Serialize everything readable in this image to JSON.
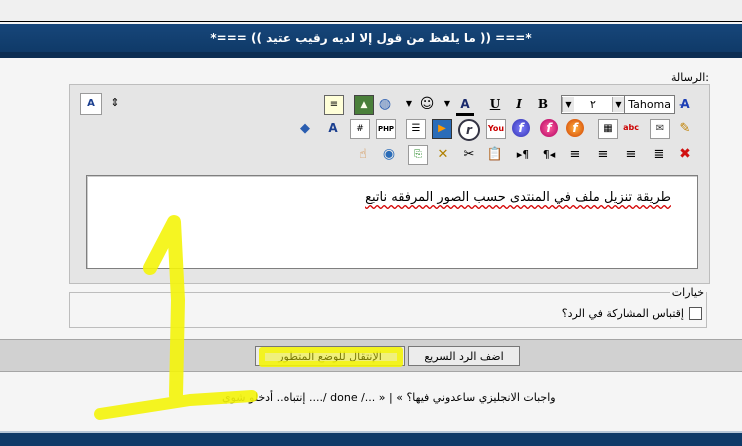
{
  "header": {
    "title": "*=== (( ما يلفظ من قول إلا لديه رقيب عتيد )) ===*"
  },
  "editor": {
    "label": "الرسالة:",
    "font_name": "Tahoma",
    "font_size": "٢",
    "toolbar_row1_icons": [
      "toggle-mode-icon",
      "bold-icon",
      "italic-icon",
      "underline-icon",
      "font-color-icon",
      "smilie-icon",
      "insert-link-icon",
      "insert-image-icon",
      "quote-icon"
    ],
    "toolbar_row2_icons": [
      "remove-format-icon",
      "wysiwyg-icon",
      "table-icon",
      "flash-icon",
      "flash-icon",
      "flash-icon",
      "youtube-icon",
      "real-player-icon",
      "media-player-icon",
      "list-icon",
      "php-icon",
      "code-icon",
      "highlight-icon",
      "book-icon"
    ],
    "toolbar_row3_icons": [
      "delete-icon",
      "align-justify-icon",
      "align-right-icon",
      "align-center-icon",
      "align-left-icon",
      "rtl-icon",
      "ltr-icon",
      "paste-icon",
      "cut-icon",
      "clear-icon",
      "copy-icon",
      "web-icon",
      "hand-icon"
    ],
    "message_text": "طريقة تنزيل ملف في المنتدى حسب الصور المرفقه ناتبع"
  },
  "options": {
    "legend": "خيارات",
    "quote_label": "إقتباس المشاركة في الرد؟",
    "quote_checked": false
  },
  "buttons": {
    "quick_reply": "اضف الرد السريع",
    "advanced": "الإنتقال للوضع المتطور"
  },
  "links": {
    "prev": "« واجبات الانجليزي ساعدوني فيها؟",
    "separator": "|",
    "next": "إنتباه.. أدخلو شوي ..../ done /... »"
  },
  "colors": {
    "header_blue": "#0f3a68",
    "highlight_yellow": "#f4f40a"
  }
}
